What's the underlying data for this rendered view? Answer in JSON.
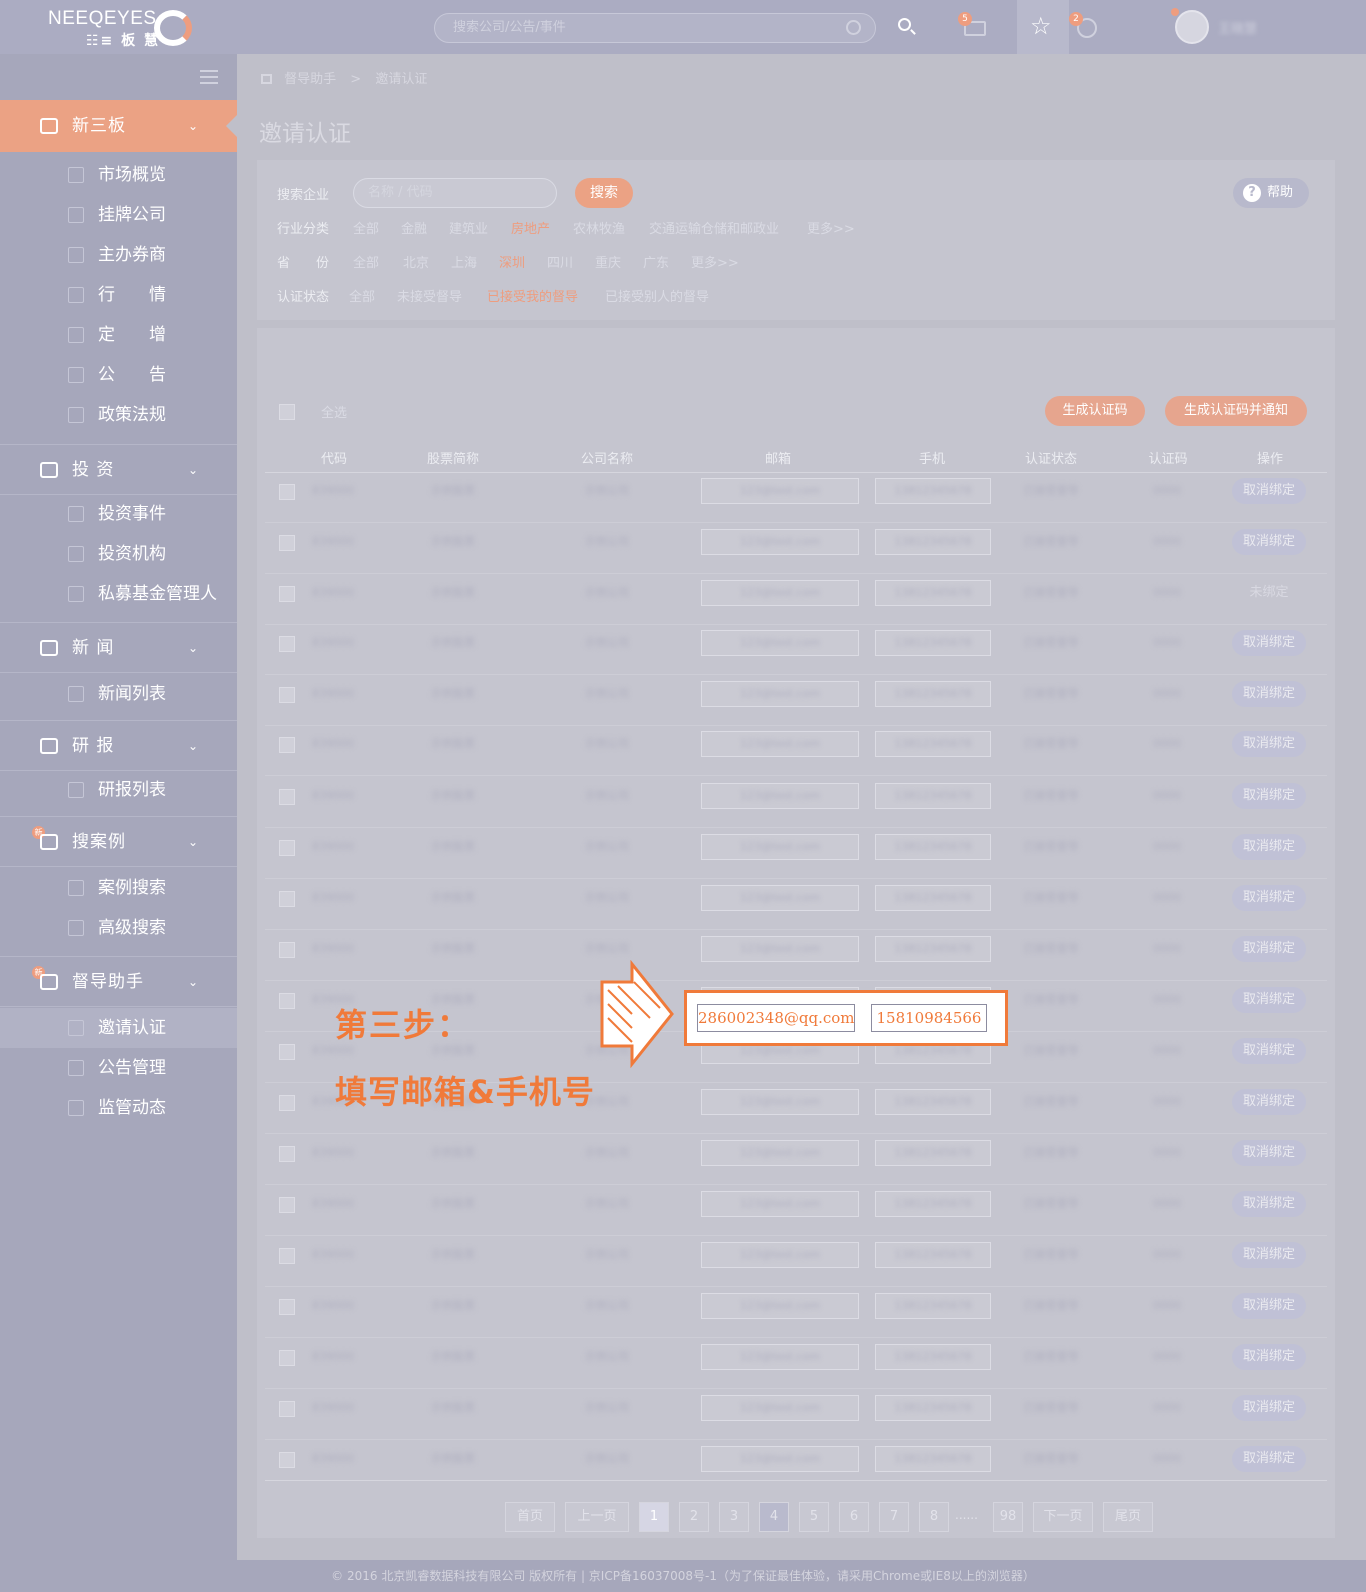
{
  "header": {
    "logo_en": "NEEQEYES",
    "logo_cn": "☷≡ 板 慧",
    "search_placeholder": "搜索公司/公告/事件",
    "mail_badge": "5",
    "notice_badge": "2",
    "username": "王晓慧"
  },
  "sidebar": {
    "active": "新三板",
    "sections": [
      {
        "label": "投 资",
        "items": [
          "投资事件",
          "投资机构",
          "私募基金管理人"
        ]
      },
      {
        "label": "新 闻",
        "items": [
          "新闻列表"
        ]
      },
      {
        "label": "研 报",
        "items": [
          "研报列表"
        ]
      },
      {
        "label": "搜案例",
        "badge": "新",
        "items": [
          "案例搜索",
          "高级搜索"
        ]
      },
      {
        "label": "督导助手",
        "badge": "新",
        "items": [
          "邀请认证",
          "公告管理",
          "监管动态"
        ]
      }
    ],
    "xsb_items": [
      "市场概览",
      "挂牌公司",
      "主办券商",
      "行　　情",
      "定　　增",
      "公　　告",
      "政策法规"
    ]
  },
  "breadcrumb": [
    "督导助手",
    ">",
    "邀请认证"
  ],
  "page_title": "邀请认证",
  "filters": {
    "search_label": "搜索企业",
    "search_placeholder": "名称 / 代码",
    "search_button": "搜索",
    "help_button": "帮助",
    "industry_label": "行业分类",
    "industry_options": [
      "全部",
      "金融",
      "建筑业",
      "房地产",
      "农林牧渔",
      "交通运输仓储和邮政业",
      "更多>>"
    ],
    "province_label": "省　　份",
    "province_options": [
      "全部",
      "北京",
      "上海",
      "深圳",
      "四川",
      "重庆",
      "广东",
      "更多>>"
    ],
    "status_label": "认证状态",
    "status_options": [
      "全部",
      "未接受督导",
      "已接受我的督导",
      "已接受别人的督导"
    ]
  },
  "list": {
    "select_all": "全选",
    "gen_code": "生成认证码",
    "gen_notify": "生成认证码并通知",
    "columns": [
      "代码",
      "股票简称",
      "公司名称",
      "邮箱",
      "手机",
      "认证状态",
      "认证码",
      "操作"
    ],
    "row_placeholder": {
      "code": "839000",
      "short": "示例股票",
      "company": "示例公司",
      "email": "123@test.com",
      "phone": "13812345678",
      "status": "已接受督导",
      "auth_code": "0000"
    },
    "action_unbind": "取消绑定",
    "action_unbound": "未绑定",
    "highlight_email": "286002348@qq.com",
    "highlight_phone": "15810984566"
  },
  "pagination": [
    "首页",
    "上一页",
    "1",
    "2",
    "3",
    "4",
    "5",
    "6",
    "7",
    "8",
    "......",
    "98",
    "下一页",
    "尾页"
  ],
  "annotation": {
    "step_title": "第三步：",
    "step_text": "填写邮箱&手机号"
  },
  "footer": "© 2016 北京凯睿数据科技有限公司 版权所有 | 京ICP备16037008号-1（为了保证最佳体验，请采用Chrome或IE8以上的浏览器）",
  "colors": {
    "accent": "#eba284",
    "annotation": "#f07a3a",
    "sidebar": "#a6a7bb"
  }
}
